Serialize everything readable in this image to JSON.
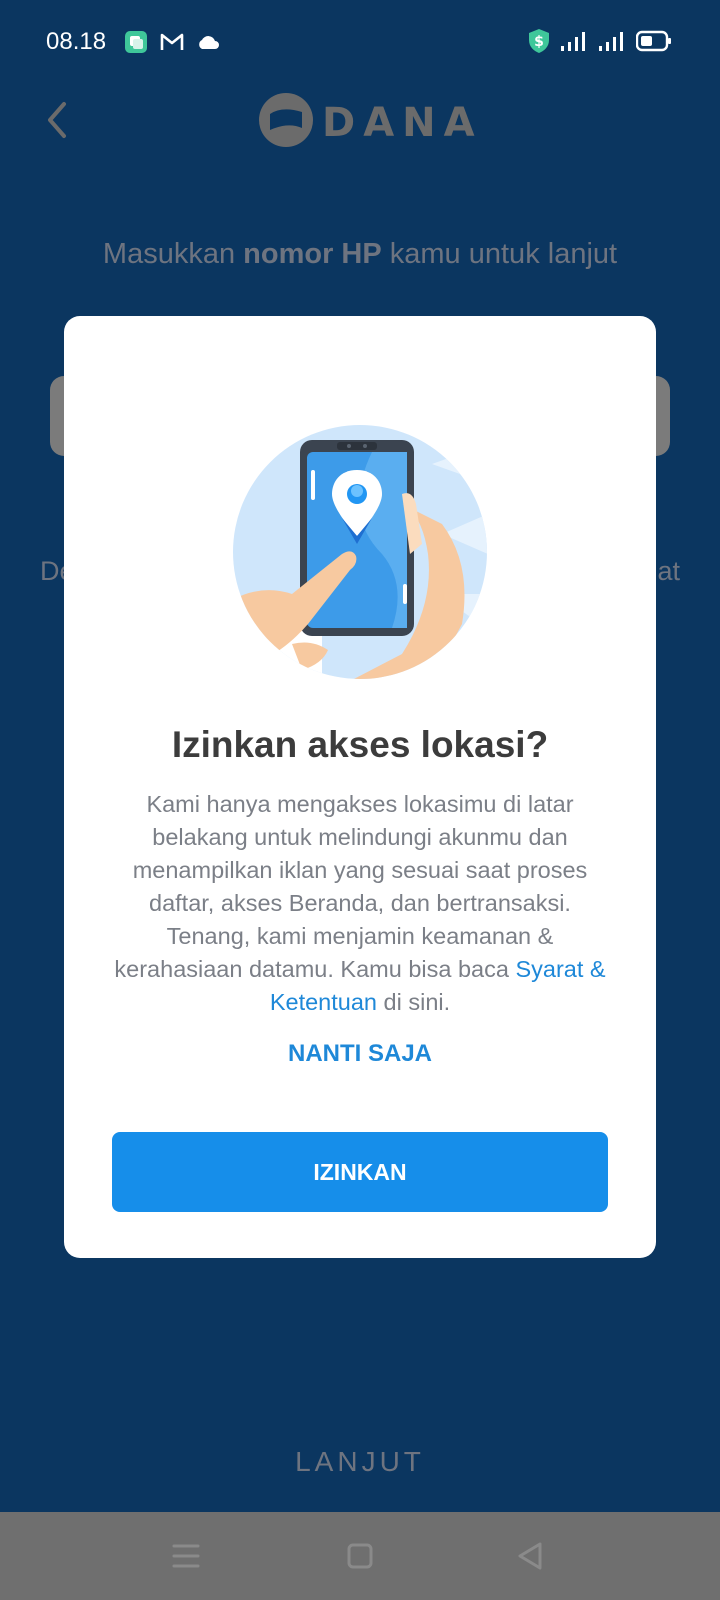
{
  "status_bar": {
    "time": "08.18",
    "icons": [
      "app-notification-icon",
      "gmail-icon",
      "cloud-icon",
      "security-shield-icon",
      "signal-icon",
      "signal-icon",
      "battery-icon"
    ]
  },
  "header": {
    "brand": "DANA",
    "back_icon": "chevron-left-icon"
  },
  "page": {
    "prompt_prefix": "Masukkan ",
    "prompt_bold": "nomor HP",
    "prompt_suffix": " kamu untuk lanjut",
    "fragment_left": "De",
    "fragment_right": "at",
    "next_label": "LANJUT"
  },
  "modal": {
    "illustration": "phone-location-pin-illustration",
    "title": "Izinkan akses lokasi?",
    "body_text": "Kami hanya mengakses lokasimu di latar belakang untuk melindungi akunmu dan menampilkan iklan yang sesuai saat proses daftar, akses Beranda, dan bertransaksi. Tenang, kami menjamin keamanan & kerahasiaan datamu. Kamu bisa baca ",
    "body_link": "Syarat & Ketentuan",
    "body_suffix": " di sini.",
    "later_label": "NANTI SAJA",
    "allow_label": "IZINKAN"
  },
  "nav_bar": {
    "icons": [
      "menu-icon",
      "home-icon",
      "back-icon"
    ]
  },
  "colors": {
    "background": "#0b3660",
    "accent": "#168eea",
    "link": "#1e88d8"
  }
}
